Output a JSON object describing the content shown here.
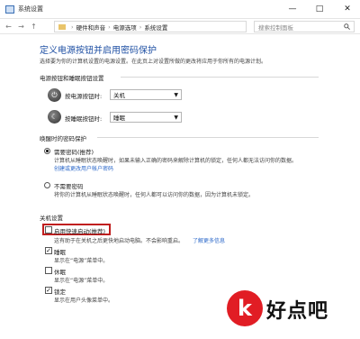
{
  "window": {
    "title": "系统设置",
    "minimize": "—",
    "maximize": "□",
    "close": "✕"
  },
  "nav": {
    "back": "←",
    "forward": "→",
    "up": "↑"
  },
  "breadcrumb": [
    "硬件和声音",
    "电源选项",
    "系统设置"
  ],
  "breadcrumb_sep": "›",
  "search": {
    "placeholder": "搜索控制面板",
    "icon": "search-icon"
  },
  "page": {
    "title": "定义电源按钮并启用密码保护",
    "subtitle": "选择要为你的计算机设置的电源设置。在此页上对设置所做的更改将应用于你所有的电源计划。"
  },
  "power_buttons": {
    "heading": "电源按钮和睡眠按钮设置",
    "rows": [
      {
        "label": "按电源按钮时:",
        "value": "关机",
        "icon": "power-icon"
      },
      {
        "label": "按睡眠按钮时:",
        "value": "睡眠",
        "icon": "moon-icon"
      }
    ]
  },
  "password": {
    "heading": "唤醒时的密码保护",
    "options": [
      {
        "label": "需要密码(推荐)",
        "selected": true,
        "desc": "计算机从睡眠状态唤醒时，如果未输入正确的密码来解除计算机的锁定，任何人都无法访问你的数据。",
        "link": "创建或更改用户帐户密码"
      },
      {
        "label": "不需要密码",
        "selected": false,
        "desc": "将你的计算机从睡眠状态唤醒时，任何人都可以访问你的数据，因为计算机未锁定。"
      }
    ]
  },
  "shutdown": {
    "heading": "关机设置",
    "items": [
      {
        "label": "启用快速启动(推荐)",
        "checked": false,
        "desc": "这有助于在关机之后更快地启动电脑。不会影响重启。",
        "link": "了解更多信息"
      },
      {
        "label": "睡眠",
        "checked": true,
        "desc": "显示在“电源”菜单中。"
      },
      {
        "label": "休眠",
        "checked": false,
        "desc": "显示在“电源”菜单中。"
      },
      {
        "label": "锁定",
        "checked": true,
        "desc": "显示在用户头像菜单中。"
      }
    ]
  },
  "watermark": {
    "mark": "k",
    "text": "好点吧"
  },
  "colors": {
    "heading": "#1e4fa3",
    "link": "#2a67c9",
    "highlight": "#c01f1f",
    "watermark": "#e11d24"
  }
}
